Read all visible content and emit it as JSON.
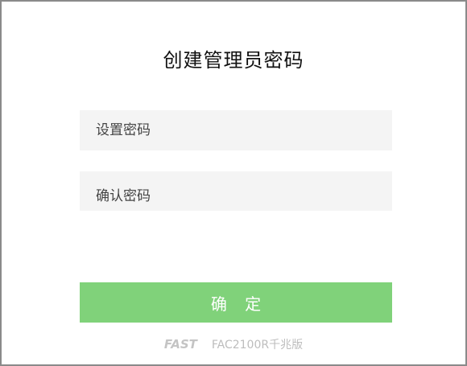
{
  "page": {
    "title": "创建管理员密码"
  },
  "form": {
    "password_placeholder": "设置密码",
    "confirm_placeholder": "确认密码",
    "submit_label": "确 定"
  },
  "footer": {
    "brand": "FAST",
    "model": "FAC2100R千兆版"
  },
  "colors": {
    "accent": "#80d27a",
    "field_bg": "#f4f4f4",
    "border": "#8a8a8a"
  }
}
